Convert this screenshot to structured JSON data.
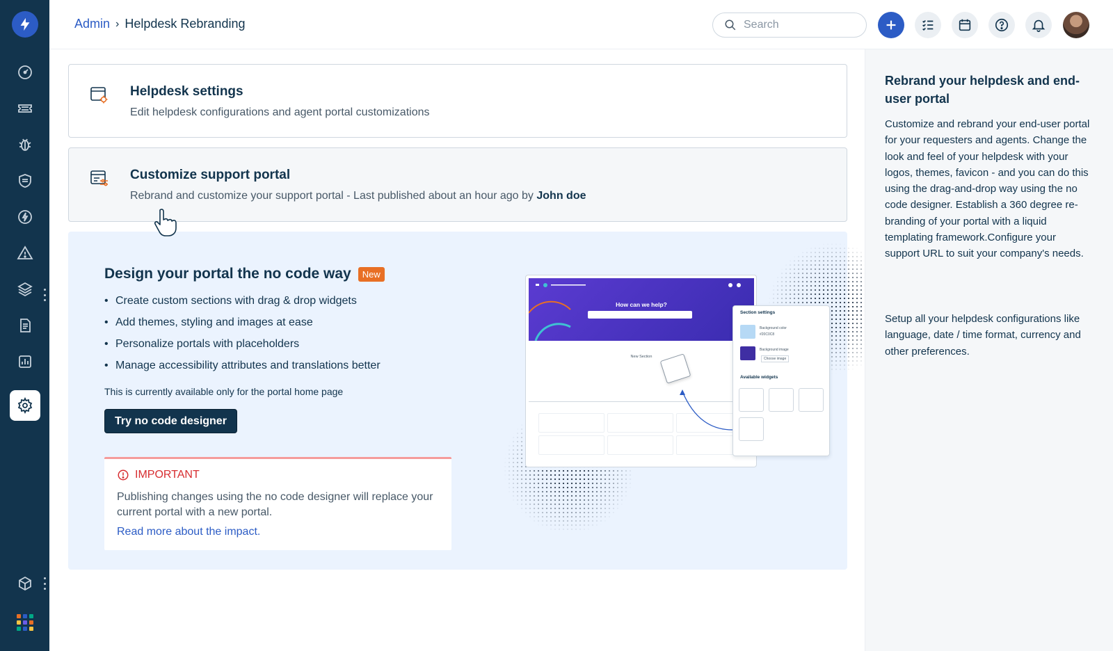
{
  "colors": {
    "sidebar": "#12344d",
    "accent": "#2c5cc5",
    "new_badge": "#e86f25",
    "important": "#d72d30",
    "promo_bg": "#ebf3fe"
  },
  "sidebar": {
    "items": [
      {
        "icon": "dashboard-gauge-icon"
      },
      {
        "icon": "ticket-icon"
      },
      {
        "icon": "bug-icon"
      },
      {
        "icon": "shield-icon"
      },
      {
        "icon": "lightning-icon"
      },
      {
        "icon": "warning-icon"
      },
      {
        "icon": "layers-icon"
      },
      {
        "icon": "document-icon"
      },
      {
        "icon": "reports-chart-icon"
      },
      {
        "icon": "settings-gear-icon",
        "active": true
      },
      {
        "icon": "cube-icon"
      },
      {
        "icon": "apps-grid-icon"
      }
    ]
  },
  "header": {
    "breadcrumb_root": "Admin",
    "breadcrumb_current": "Helpdesk Rebranding",
    "search_placeholder": "Search"
  },
  "cards": [
    {
      "title": "Helpdesk settings",
      "description": "Edit helpdesk configurations and agent portal customizations"
    },
    {
      "title": "Customize support portal",
      "description": "Rebrand and customize your support portal - Last published about an hour ago by ",
      "author": "John doe"
    }
  ],
  "promo": {
    "title": "Design your portal the no code way",
    "badge": "New",
    "bullets": [
      "Create custom sections with drag & drop widgets",
      "Add themes, styling and images at ease",
      "Personalize portals with placeholders",
      "Manage accessibility attributes and translations better"
    ],
    "availability": "This is currently available only for the portal home page",
    "button": "Try no code designer",
    "important": {
      "label": "IMPORTANT",
      "text": "Publishing changes using the no code designer will replace your current portal with a new portal.",
      "link": "Read more about the impact."
    },
    "illustration": {
      "hero_title": "How can we help?",
      "section_label": "New Section",
      "panel_title": "Section settings",
      "bg_color_label": "Background color",
      "bg_color_value": "#20C0C8",
      "bg_image_label": "Background image",
      "choose_image": "Choose image",
      "widgets_title": "Available widgets"
    }
  },
  "right_panel": {
    "title": "Rebrand your helpdesk and end-user portal",
    "paragraph1": "Customize and rebrand your end-user portal for your requesters and agents. Change the look and feel of your helpdesk with your logos, themes, favicon - and you can do this using the drag-and-drop way using the no code designer. Establish a 360 degree re-branding of your portal with a liquid templating framework.Configure your support URL to suit your company's needs.",
    "paragraph2": "Setup all your helpdesk configurations like language, date / time format, currency and other preferences."
  }
}
